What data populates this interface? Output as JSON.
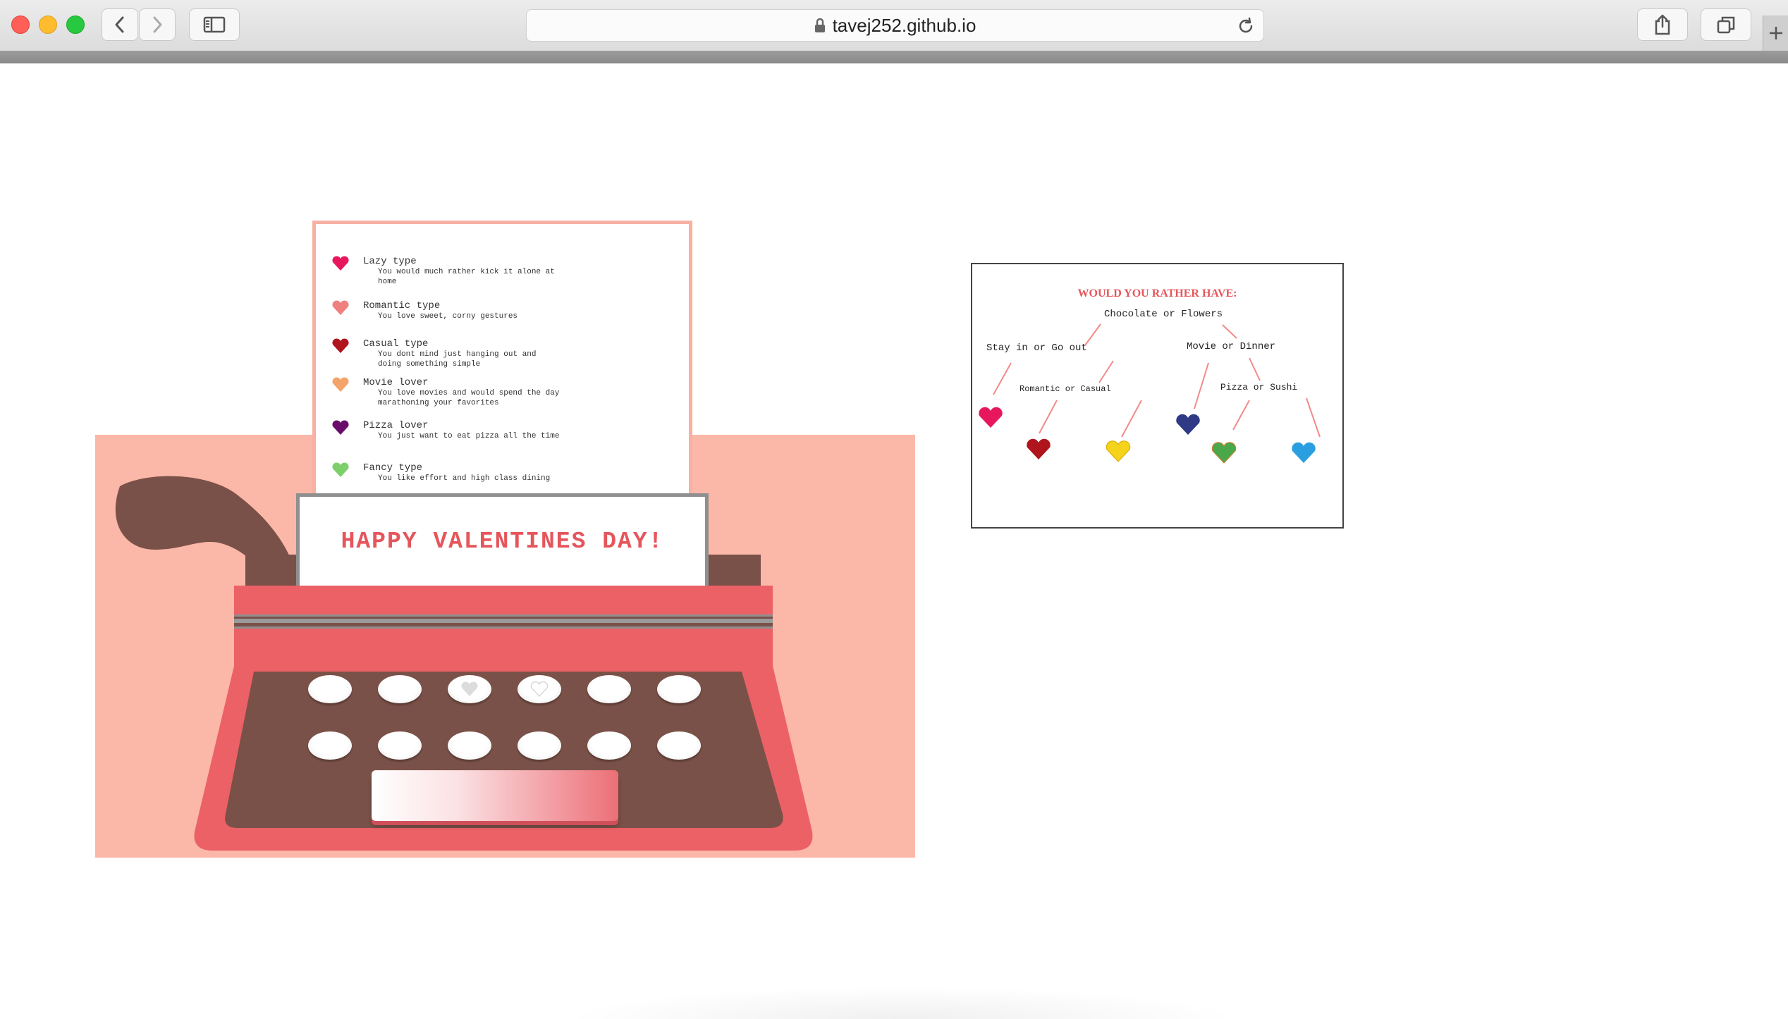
{
  "browser": {
    "url": "tavej252.github.io",
    "icons": [
      "close-light",
      "minimize-light",
      "zoom-light",
      "back-icon",
      "forward-icon",
      "sidebar-icon",
      "lock-icon",
      "reload-icon",
      "share-icon",
      "tabs-icon",
      "new-tab-icon"
    ]
  },
  "paper": {
    "entries": [
      {
        "title": "Lazy type",
        "desc": "You would much rather kick it alone at home",
        "color": "#e8175d"
      },
      {
        "title": "Romantic type",
        "desc": "You love sweet, corny gestures",
        "color": "#f08080"
      },
      {
        "title": "Casual type",
        "desc": "You dont mind just hanging out and doing something simple",
        "color": "#b0141c"
      },
      {
        "title": "Movie lover",
        "desc": "You love movies and would spend the day marathoning your favorites",
        "color": "#f4a46a"
      },
      {
        "title": "Pizza lover",
        "desc": "You just want to eat pizza all the time",
        "color": "#6a0d6a"
      },
      {
        "title": "Fancy type",
        "desc": "You like effort and high class dining",
        "color": "#7ccf6a"
      }
    ]
  },
  "typewriter": {
    "message": "HAPPY VALENTINES DAY!",
    "colors": {
      "body": "#ec6166",
      "dark": "#7a5148",
      "backdrop": "#fbb7a7",
      "accent": "#e5565c"
    }
  },
  "flowchart": {
    "title": "WOULD YOU RATHER HAVE:",
    "root": "Chocolate or Flowers",
    "left": "Stay in or Go out",
    "left_sub": "Romantic or Casual",
    "right": "Movie or Dinner",
    "right_sub": "Pizza or Sushi",
    "heart_colors": [
      "#e8175d",
      "#b0141c",
      "#f5d31b",
      "#2f3a87",
      "#4aa84a",
      "#2a9fe0"
    ]
  }
}
